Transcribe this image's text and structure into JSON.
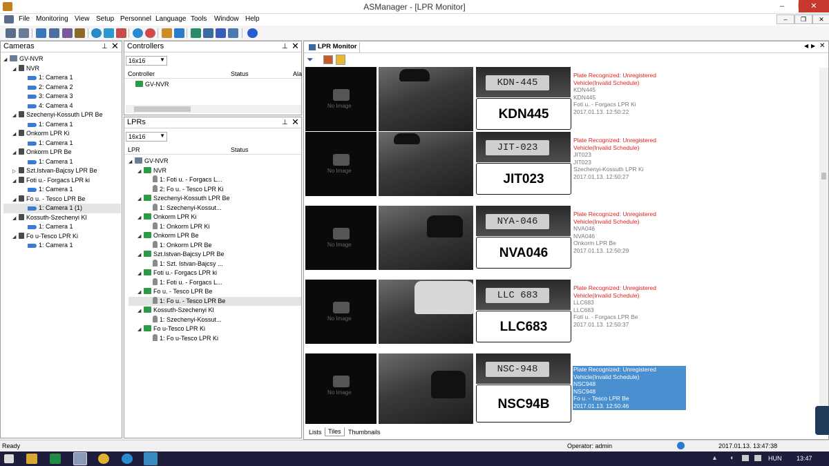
{
  "window": {
    "title": "ASManager - [LPR Monitor]",
    "controls": [
      "–",
      "❐",
      "✕"
    ]
  },
  "menu": {
    "items": [
      "File",
      "Monitoring",
      "View",
      "Setup",
      "Personnel",
      "Language",
      "Tools",
      "Window",
      "Help"
    ],
    "mdi_controls": [
      "–",
      "❐",
      "✕"
    ]
  },
  "cameras_panel": {
    "title": "Cameras",
    "tree": [
      {
        "label": "GV-NVR",
        "depth": 0,
        "icon": "server",
        "exp": "◢"
      },
      {
        "label": "NVR",
        "depth": 1,
        "icon": "dvr",
        "exp": "◢"
      },
      {
        "label": "1: Camera 1",
        "depth": 2,
        "icon": "cam"
      },
      {
        "label": "2: Camera 2",
        "depth": 2,
        "icon": "cam"
      },
      {
        "label": "3: Camera 3",
        "depth": 2,
        "icon": "cam"
      },
      {
        "label": "4: Camera 4",
        "depth": 2,
        "icon": "cam"
      },
      {
        "label": "Szechenyi-Kossuth LPR Be",
        "depth": 1,
        "icon": "dvr",
        "exp": "◢"
      },
      {
        "label": "1: Camera 1",
        "depth": 2,
        "icon": "cam"
      },
      {
        "label": "Onkorm LPR Ki",
        "depth": 1,
        "icon": "dvr",
        "exp": "◢"
      },
      {
        "label": "1: Camera 1",
        "depth": 2,
        "icon": "cam"
      },
      {
        "label": "Onkorm LPR Be",
        "depth": 1,
        "icon": "dvr",
        "exp": "◢"
      },
      {
        "label": "1: Camera 1",
        "depth": 2,
        "icon": "cam"
      },
      {
        "label": "Szt.Istvan-Bajcsy LPR Be",
        "depth": 1,
        "icon": "dvr",
        "exp": "▷"
      },
      {
        "label": "Foti u.- Forgacs LPR ki",
        "depth": 1,
        "icon": "dvr",
        "exp": "◢"
      },
      {
        "label": "1: Camera 1",
        "depth": 2,
        "icon": "cam"
      },
      {
        "label": "Fo u. - Tesco LPR Be",
        "depth": 1,
        "icon": "dvr",
        "exp": "◢"
      },
      {
        "label": "1: Camera 1 (1)",
        "depth": 2,
        "icon": "cam",
        "selected": true
      },
      {
        "label": "Kossuth-Szechenyi Kl",
        "depth": 1,
        "icon": "dvr",
        "exp": "◢"
      },
      {
        "label": "1: Camera 1",
        "depth": 2,
        "icon": "cam"
      },
      {
        "label": "Fo u-Tesco LPR Ki",
        "depth": 1,
        "icon": "dvr",
        "exp": "◢"
      },
      {
        "label": "1: Camera 1",
        "depth": 2,
        "icon": "cam"
      }
    ]
  },
  "controllers_panel": {
    "title": "Controllers",
    "combo": "16x16",
    "columns": [
      "Controller",
      "Status",
      "Ala"
    ],
    "rows": [
      "GV-NVR"
    ]
  },
  "lprs_panel": {
    "title": "LPRs",
    "combo": "16x16",
    "columns": [
      "LPR",
      "Status"
    ],
    "tree": [
      {
        "label": "GV-NVR",
        "depth": 0,
        "icon": "server",
        "exp": "◢"
      },
      {
        "label": "NVR",
        "depth": 1,
        "icon": "lpr",
        "exp": "◢"
      },
      {
        "label": "1: Foti u. - Forgacs L...",
        "depth": 2,
        "icon": "pl"
      },
      {
        "label": "2: Fo u. - Tesco LPR Ki",
        "depth": 2,
        "icon": "pl"
      },
      {
        "label": "Szechenyi-Kossuth LPR Be",
        "depth": 1,
        "icon": "lpr",
        "exp": "◢"
      },
      {
        "label": "1: Szechenyi-Kossut...",
        "depth": 2,
        "icon": "pl"
      },
      {
        "label": "Onkorm LPR Ki",
        "depth": 1,
        "icon": "lpr",
        "exp": "◢"
      },
      {
        "label": "1: Onkorm LPR Ki",
        "depth": 2,
        "icon": "pl"
      },
      {
        "label": "Onkorm LPR Be",
        "depth": 1,
        "icon": "lpr",
        "exp": "◢"
      },
      {
        "label": "1: Onkorm LPR Be",
        "depth": 2,
        "icon": "pl"
      },
      {
        "label": "Szt.Istvan-Bajcsy LPR Be",
        "depth": 1,
        "icon": "lpr",
        "exp": "◢"
      },
      {
        "label": "1: Szt. Istvan-Bajcsy ...",
        "depth": 2,
        "icon": "pl"
      },
      {
        "label": "Foti u.- Forgacs LPR ki",
        "depth": 1,
        "icon": "lpr",
        "exp": "◢"
      },
      {
        "label": "1: Foti u. - Forgacs L...",
        "depth": 2,
        "icon": "pl"
      },
      {
        "label": "Fo u. - Tesco LPR Be",
        "depth": 1,
        "icon": "lpr",
        "exp": "◢"
      },
      {
        "label": "1: Fo u. - Tesco LPR Be",
        "depth": 2,
        "icon": "pl",
        "selected": true
      },
      {
        "label": "Kossuth-Szechenyi Kl",
        "depth": 1,
        "icon": "lpr",
        "exp": "◢"
      },
      {
        "label": "1: Szechenyi-Kossut...",
        "depth": 2,
        "icon": "pl"
      },
      {
        "label": "Fo u-Tesco LPR Ki",
        "depth": 1,
        "icon": "lpr",
        "exp": "◢"
      },
      {
        "label": "1: Fo u-Tesco LPR Ki",
        "depth": 2,
        "icon": "pl"
      }
    ]
  },
  "monitor": {
    "tab_title": "LPR Monitor",
    "no_image": "No Image",
    "records": [
      {
        "crop_text": "KDN-445",
        "plate": "KDN445",
        "line1": "Plate Recognized: Unregistered",
        "line2": "Vehicle(Invalid Schedule)",
        "text1": "KDN445",
        "text2": "KDN445",
        "location": "Foti u. - Forgacs LPR Ki",
        "time": "2017.01.13. 12:50:22",
        "highlighted": false
      },
      {
        "crop_text": "JIT-023",
        "plate": "JIT023",
        "line1": "Plate Recognized: Unregistered",
        "line2": "Vehicle(Invalid Schedule)",
        "text1": "JIT023",
        "text2": "JIT023",
        "location": "Szechenyi-Kossuth LPR Ki",
        "time": "2017.01.13. 12:50:27",
        "highlighted": false
      },
      {
        "crop_text": "NYA-046",
        "plate": "NVA046",
        "line1": "Plate Recognized: Unregistered",
        "line2": "Vehicle(Invalid Schedule)",
        "text1": "NVA046",
        "text2": "NVA046",
        "location": "Onkorm LPR Be",
        "time": "2017.01.13. 12:50:29",
        "highlighted": false
      },
      {
        "crop_text": "LLC 683",
        "plate": "LLC683",
        "line1": "Plate Recognized: Unregistered",
        "line2": "Vehicle(Invalid Schedule)",
        "text1": "LLC683",
        "text2": "LLC683",
        "location": "Foti u. - Forgacs LPR Be",
        "time": "2017.01.13. 12:50:37",
        "highlighted": false
      },
      {
        "crop_text": "NSC-948",
        "plate": "NSC94B",
        "line1": "Plate Recognized: Unregistered",
        "line2": "Vehicle(Invalid Schedule)",
        "text1": "NSC948",
        "text2": "NSC948",
        "location": "Fo u. - Tesco LPR Be",
        "time": "2017.01.13. 12:50:46",
        "highlighted": true
      }
    ],
    "view_tabs": [
      "Lists",
      "Tiles",
      "Thumbnails"
    ],
    "active_view": "Tiles"
  },
  "status": {
    "left": "Ready",
    "operator": "Operator: admin",
    "datetime": "2017.01.13. 13:47:38"
  },
  "taskbar": {
    "lang": "HUN",
    "clock": "13:47"
  },
  "colors": {
    "alert_red": "#e02020",
    "selection_blue": "#4a8fd0",
    "taskbar": "#1e1e3c"
  }
}
